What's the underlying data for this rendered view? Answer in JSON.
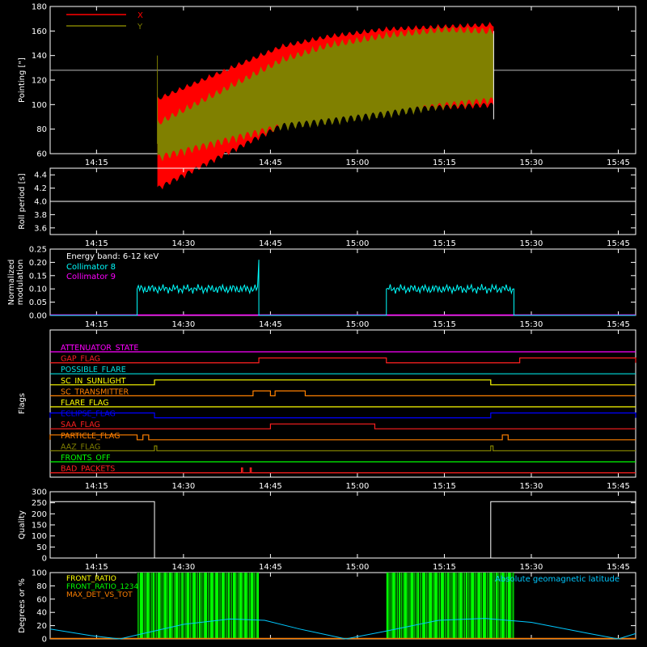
{
  "colors": {
    "background": "#000000",
    "axis": "#ffffff",
    "x_pointing": "#ff0000",
    "y_pointing": "#808000",
    "collimator8": "#00ffff",
    "collimator9": "#ff00ff",
    "front_ratio": "#ffff00",
    "front_ratio_2": "#00ff00",
    "max_det": "#ff8000",
    "geomag": "#00c8ff"
  },
  "time_axis": {
    "start": "14:07",
    "end": "15:48",
    "ticks": [
      "14:15",
      "14:30",
      "14:45",
      "15:00",
      "15:15",
      "15:30",
      "15:45"
    ]
  },
  "chart_data": [
    {
      "id": "pointing",
      "type": "area",
      "ylabel": "Pointing [\"]",
      "ylim": [
        60,
        180
      ],
      "yticks": [
        60,
        80,
        100,
        120,
        140,
        160,
        180
      ],
      "x_range": [
        "14:25.5",
        "15:23.5"
      ],
      "baseline": 128,
      "legend_position": "top-left",
      "series": [
        {
          "name": "X",
          "color_key": "x_pointing",
          "upper": [
            [
              14.42,
              140
            ],
            [
              14.47,
              150
            ],
            [
              14.55,
              158
            ],
            [
              14.65,
              164
            ],
            [
              14.75,
              166
            ],
            [
              14.85,
              168
            ],
            [
              15.0,
              166
            ],
            [
              15.15,
              162
            ],
            [
              15.3,
              160
            ],
            [
              15.39,
              160
            ]
          ],
          "lower": [
            [
              14.42,
              68
            ],
            [
              14.47,
              80
            ],
            [
              14.55,
              88
            ],
            [
              14.65,
              92
            ],
            [
              14.75,
              95
            ],
            [
              14.85,
              97
            ],
            [
              15.0,
              98
            ],
            [
              15.15,
              98
            ],
            [
              15.3,
              97
            ],
            [
              15.39,
              96
            ]
          ]
        },
        {
          "name": "Y",
          "color_key": "y_pointing",
          "upper": [
            [
              14.42,
              128
            ],
            [
              14.47,
              140
            ],
            [
              14.55,
              152
            ],
            [
              14.65,
              160
            ],
            [
              14.75,
              165
            ],
            [
              14.85,
              163
            ],
            [
              15.0,
              156
            ],
            [
              15.15,
              150
            ],
            [
              15.3,
              145
            ],
            [
              15.39,
              140
            ]
          ],
          "lower": [
            [
              14.42,
              72
            ],
            [
              14.47,
              78
            ],
            [
              14.55,
              82
            ],
            [
              14.65,
              88
            ],
            [
              14.75,
              95
            ],
            [
              14.85,
              100
            ],
            [
              15.0,
              98
            ],
            [
              15.15,
              96
            ],
            [
              15.3,
              95
            ],
            [
              15.39,
              95
            ]
          ]
        }
      ]
    },
    {
      "id": "roll",
      "type": "line",
      "ylabel": "Roll period [s]",
      "ylim": [
        3.5,
        4.5
      ],
      "yticks": [
        "3.6",
        "3.8",
        "4.0",
        "4.2",
        "4.4"
      ],
      "series": [
        {
          "color_key": "axis",
          "x": [
            "14:07",
            "15:48"
          ],
          "y": [
            4.0,
            4.0
          ]
        }
      ]
    },
    {
      "id": "modulation",
      "type": "line",
      "ylabel": "Normalized modulation",
      "ylabel_lines": [
        "Normalized",
        "modulation"
      ],
      "ylim": [
        0,
        0.25
      ],
      "yticks": [
        "0.00",
        "0.05",
        "0.10",
        "0.15",
        "0.20",
        "0.25"
      ],
      "legend_position": "top-left",
      "legend_title": "Energy band: 6-12 keV",
      "series": [
        {
          "name": "Collimator 8",
          "color_key": "collimator8",
          "segments": [
            {
              "start": "14:22",
              "end": "14:43",
              "level": 0.1,
              "spike": 0.21
            },
            {
              "start": "15:05",
              "end": "15:27",
              "level": 0.1,
              "spike": 0
            }
          ]
        },
        {
          "name": "Collimator 9",
          "color_key": "collimator9",
          "constant": 0.0
        }
      ]
    },
    {
      "id": "flags",
      "type": "line",
      "ylabel": "Flags",
      "series": [
        {
          "name": "ATTENUATOR_STATE",
          "color": "#ff00ff",
          "steps": []
        },
        {
          "name": "GAP_FLAG",
          "color": "#ff2020",
          "steps": [
            [
              "14:43",
              "15:05"
            ],
            [
              "15:28",
              "15:48"
            ]
          ]
        },
        {
          "name": "POSSIBLE_FLARE",
          "color": "#00e0e0",
          "steps": []
        },
        {
          "name": "SC_IN_SUNLIGHT",
          "color": "#ffff00",
          "steps": [
            [
              "14:25",
              "15:23"
            ]
          ],
          "inverted": false
        },
        {
          "name": "SC_TRANSMITTER",
          "color": "#ff8000",
          "steps": [
            [
              "14:42",
              "14:45"
            ],
            [
              "14:45.8",
              "14:51"
            ]
          ]
        },
        {
          "name": "FLARE_FLAG",
          "color": "#ffff00",
          "steps": []
        },
        {
          "name": "ECLIPSE_FLAG",
          "color": "#0000ff",
          "steps": [
            [
              "14:07",
              "14:25"
            ],
            [
              "15:23",
              "15:48"
            ]
          ]
        },
        {
          "name": "SAA_FLAG",
          "color": "#ff2020",
          "steps": [
            [
              "14:45",
              "15:03"
            ]
          ]
        },
        {
          "name": "PARTICLE_FLAG",
          "color": "#ff8000",
          "steps": [
            [
              "14:07",
              "14:22"
            ],
            [
              "14:23",
              "14:24"
            ],
            [
              "15:25",
              "15:26"
            ]
          ]
        },
        {
          "name": "AAZ_FLAG",
          "color": "#808000",
          "steps": [
            [
              "14:25",
              "14:25.4"
            ],
            [
              "15:23",
              "15:23.4"
            ]
          ]
        },
        {
          "name": "FRONTS_OFF",
          "color": "#00ff00",
          "steps": []
        },
        {
          "name": "BAD_PACKETS",
          "color": "#ff2020",
          "steps": [
            [
              "14:40",
              "14:40.2"
            ],
            [
              "14:41.5",
              "14:41.7"
            ]
          ]
        }
      ]
    },
    {
      "id": "quality",
      "type": "line",
      "ylabel": "Quality",
      "ylim": [
        0,
        300
      ],
      "yticks": [
        "0",
        "50",
        "100",
        "150",
        "200",
        "250",
        "300"
      ],
      "series": [
        {
          "color_key": "axis",
          "segments": [
            [
              "14:07",
              "14:25",
              255
            ],
            [
              "14:25",
              "15:23",
              0
            ],
            [
              "15:23",
              "15:48",
              255
            ]
          ]
        }
      ]
    },
    {
      "id": "ratios",
      "type": "line",
      "ylabel": "Degrees or %",
      "ylim": [
        0,
        100
      ],
      "yticks": [
        "0",
        "20",
        "40",
        "60",
        "80",
        "100"
      ],
      "legend_position": "top-left",
      "legend_right": "Absolute geomagnetic latitude",
      "series": [
        {
          "name": "FRONT_RATIO",
          "color_key": "front_ratio"
        },
        {
          "name": "FRONT_RATIO_1234",
          "color_key": "front_ratio_2",
          "blocks": [
            [
              "14:22",
              "14:43"
            ],
            [
              "15:05",
              "15:27"
            ]
          ]
        },
        {
          "name": "MAX_DET_VS_TOT",
          "color_key": "max_det"
        },
        {
          "name": "Absolute geomagnetic latitude",
          "color_key": "geomag",
          "points": [
            [
              "14:07",
              15
            ],
            [
              "14:14",
              5
            ],
            [
              "14:19",
              0
            ],
            [
              "14:30",
              22
            ],
            [
              "14:38",
              30
            ],
            [
              "14:44",
              28
            ],
            [
              "14:50",
              15
            ],
            [
              "14:58",
              0
            ],
            [
              "15:05",
              12
            ],
            [
              "15:14",
              28
            ],
            [
              "15:22",
              31
            ],
            [
              "15:30",
              25
            ],
            [
              "15:40",
              8
            ],
            [
              "15:45",
              0
            ],
            [
              "15:48",
              8
            ]
          ]
        }
      ]
    }
  ]
}
